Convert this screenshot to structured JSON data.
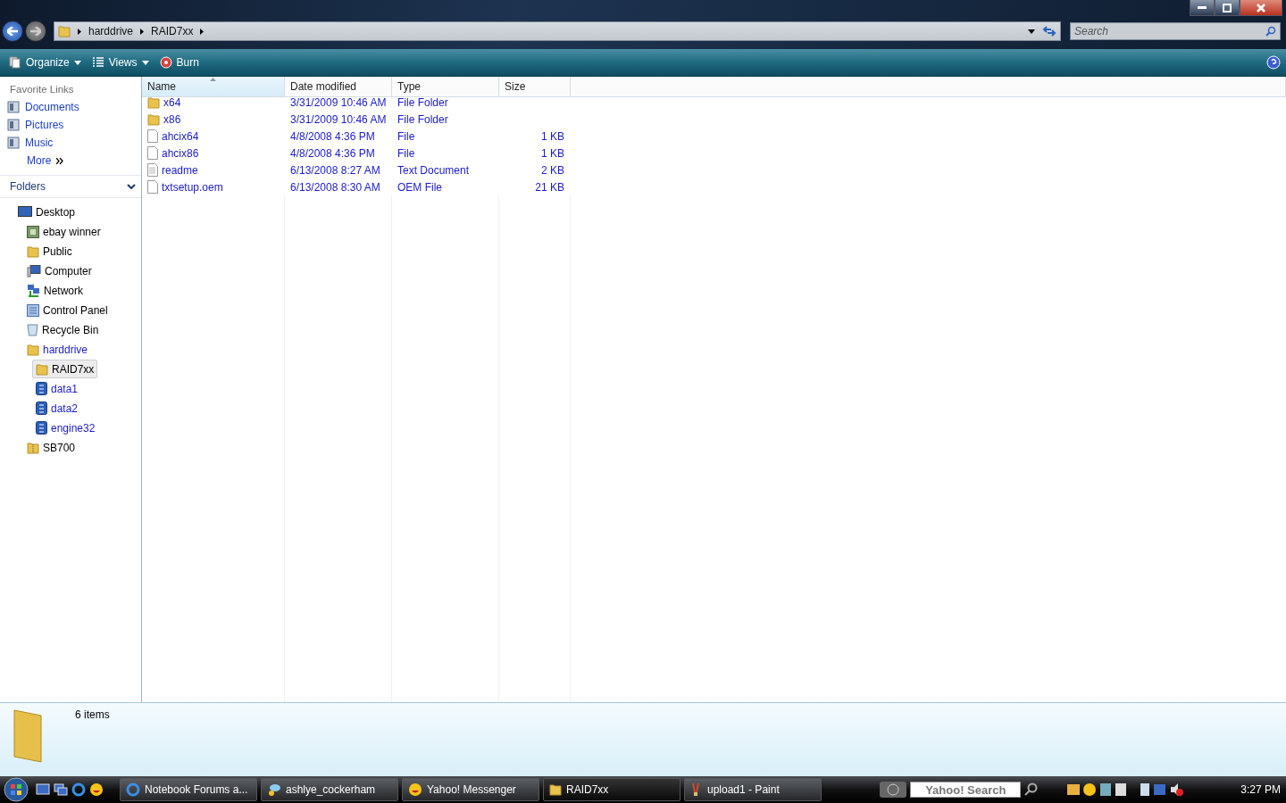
{
  "window": {
    "buttons": [
      {
        "kind": "minimize"
      },
      {
        "kind": "restore"
      },
      {
        "kind": "close"
      }
    ]
  },
  "address_bar": {
    "crumbs": [
      "harddrive",
      "RAID7xx"
    ]
  },
  "search": {
    "placeholder": "Search"
  },
  "toolbar": {
    "items": [
      {
        "label": "Organize",
        "kind": "organize"
      },
      {
        "label": "Views",
        "kind": "views"
      },
      {
        "label": "Burn",
        "kind": "burn"
      }
    ]
  },
  "favorite_links": {
    "title": "Favorite Links",
    "items": [
      {
        "label": "Documents"
      },
      {
        "label": "Pictures"
      },
      {
        "label": "Music"
      }
    ],
    "more": "More"
  },
  "folders": {
    "title": "Folders",
    "tree": [
      {
        "label": "Desktop",
        "kind": "desktop",
        "selected": false,
        "compressed": false,
        "children": [
          {
            "label": "ebay winner",
            "kind": "picture",
            "selected": false,
            "compressed": false
          },
          {
            "label": "Public",
            "kind": "folder",
            "selected": false,
            "compressed": false
          },
          {
            "label": "Computer",
            "kind": "computer",
            "selected": false,
            "compressed": false
          },
          {
            "label": "Network",
            "kind": "network",
            "selected": false,
            "compressed": false
          },
          {
            "label": "Control Panel",
            "kind": "control",
            "selected": false,
            "compressed": false
          },
          {
            "label": "Recycle Bin",
            "kind": "recycle",
            "selected": false,
            "compressed": false
          },
          {
            "label": "harddrive",
            "kind": "folder",
            "selected": false,
            "compressed": true,
            "children": [
              {
                "label": "RAID7xx",
                "kind": "folder",
                "selected": true,
                "compressed": false
              },
              {
                "label": "data1",
                "kind": "cabinet",
                "selected": false,
                "compressed": true
              },
              {
                "label": "data2",
                "kind": "cabinet",
                "selected": false,
                "compressed": true
              },
              {
                "label": "engine32",
                "kind": "cabinet",
                "selected": false,
                "compressed": true
              }
            ]
          },
          {
            "label": "SB700",
            "kind": "zip",
            "selected": false,
            "compressed": false
          }
        ]
      }
    ]
  },
  "table": {
    "columns": [
      "Name",
      "Date modified",
      "Type",
      "Size"
    ],
    "rows": [
      {
        "name": "x64",
        "kind": "folder",
        "date": "3/31/2009 10:46 AM",
        "type": "File Folder",
        "compressed": true
      },
      {
        "name": "x86",
        "kind": "folder",
        "date": "3/31/2009 10:46 AM",
        "type": "File Folder",
        "compressed": true
      },
      {
        "name": "ahcix64",
        "kind": "file",
        "date": "4/8/2008 4:36 PM",
        "type": "File",
        "size": "1 KB",
        "compressed": true
      },
      {
        "name": "ahcix86",
        "kind": "file",
        "date": "4/8/2008 4:36 PM",
        "type": "File",
        "size": "1 KB",
        "compressed": true
      },
      {
        "name": "readme",
        "kind": "text",
        "date": "6/13/2008 8:27 AM",
        "type": "Text Document",
        "size": "2 KB",
        "compressed": true
      },
      {
        "name": "txtsetup.oem",
        "kind": "file",
        "date": "6/13/2008 8:30 AM",
        "type": "OEM File",
        "size": "21 KB",
        "compressed": true
      }
    ]
  },
  "details_pane": {
    "count": "6 items"
  },
  "taskbar": {
    "tasks": [
      {
        "label": "Notebook Forums a...",
        "kind": "ie",
        "selected": false
      },
      {
        "label": "ashlye_cockerham",
        "kind": "chat",
        "selected": false
      },
      {
        "label": "Yahoo! Messenger",
        "kind": "smiley",
        "selected": false
      },
      {
        "label": "RAID7xx",
        "kind": "folder",
        "selected": true
      },
      {
        "label": "upload1 - Paint",
        "kind": "paint",
        "selected": false
      }
    ],
    "search_box": "Yahoo! Search",
    "clock": "3:27 PM"
  }
}
